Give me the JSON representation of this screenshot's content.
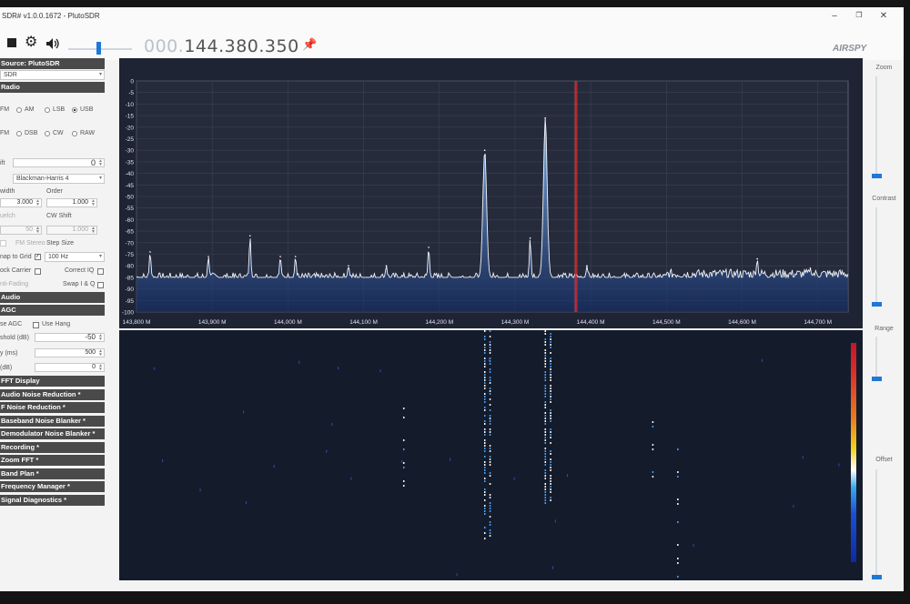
{
  "window": {
    "title": "SDR# v1.0.0.1672 - PlutoSDR",
    "minimize_icon": "minimize-icon",
    "maximize_icon": "restore-icon",
    "close_icon": "close-icon"
  },
  "toolbar": {
    "stop_icon": "stop-icon",
    "settings_icon": "gear-icon",
    "volume_icon": "speaker-icon",
    "volume_level": 0.45,
    "frequency_dim": "000.",
    "frequency_main": "144.380.350",
    "pin_icon": "pin-icon",
    "logo": "AIRSPY"
  },
  "left_panel": {
    "source_header": "Source: PlutoSDR",
    "source_select": "SDR",
    "radio_header": "Radio",
    "modes_row1": [
      "FM",
      "AM",
      "LSB",
      "USB"
    ],
    "modes_row2": [
      "FM",
      "DSB",
      "CW",
      "RAW"
    ],
    "selected_mode": "USB",
    "shift_label": "ift",
    "shift_value": "0",
    "window_select": "Blackman-Harris 4",
    "width_label": "width",
    "order_label": "Order",
    "width_value": "3.000",
    "order_value": "1.000",
    "squelch_label": "uelch",
    "cw_shift_label": "CW Shift",
    "squelch_value": "50",
    "cw_shift_value": "1.000",
    "fm_stereo_label": "FM Stereo",
    "step_size_label": "Step Size",
    "snap_label": "nap to Grid",
    "snap_checked": "✓",
    "step_select": "100 Hz",
    "lock_carrier_label": "ock Carrier",
    "correct_iq_label": "Correct IQ",
    "anti_fading_label": "nti-Fading",
    "swap_iq_label": "Swap I & Q",
    "audio_header": "Audio",
    "agc_header": "AGC",
    "use_agc_label": "se AGC",
    "use_hang_label": "Use Hang",
    "threshold_label": "shold (dB)",
    "threshold_value": "-50",
    "decay_label": "y (ms)",
    "decay_value": "500",
    "slope_label": "(dB)",
    "slope_value": "0",
    "plugin_headers": [
      "FFT Display",
      "Audio Noise Reduction *",
      "F Noise Reduction *",
      "Baseband Noise Blanker *",
      "Demodulator Noise Blanker *",
      "Recording *",
      "Zoom FFT *",
      "Band Plan *",
      "Frequency Manager *",
      "Signal Diagnostics *"
    ]
  },
  "right_panel": {
    "zoom_label": "Zoom",
    "contrast_label": "Contrast",
    "range_label": "Range",
    "offset_label": "Offset"
  },
  "chart_data": {
    "type": "line",
    "title": "",
    "xlabel": "",
    "ylabel": "",
    "y_ticks": [
      0,
      -5,
      -10,
      -15,
      -20,
      -25,
      -30,
      -35,
      -40,
      -45,
      -50,
      -55,
      -60,
      -65,
      -70,
      -75,
      -80,
      -85,
      -90,
      -95,
      -100
    ],
    "ylim": [
      -100,
      0
    ],
    "x_ticks": [
      "143,800 M",
      "143,900 M",
      "144,000 M",
      "144,100 M",
      "144,200 M",
      "144,300 M",
      "144,400 M",
      "144,500 M",
      "144,600 M",
      "144,700 M"
    ],
    "xlim_mhz": [
      143.8,
      144.74
    ],
    "tuned_frequency_mhz": 144.38035,
    "noise_floor_db": -85,
    "peaks": [
      {
        "x_mhz": 143.818,
        "y_db": -74
      },
      {
        "x_mhz": 143.895,
        "y_db": -76
      },
      {
        "x_mhz": 143.95,
        "y_db": -67
      },
      {
        "x_mhz": 143.99,
        "y_db": -76
      },
      {
        "x_mhz": 144.01,
        "y_db": -76
      },
      {
        "x_mhz": 144.08,
        "y_db": -80
      },
      {
        "x_mhz": 144.13,
        "y_db": -80
      },
      {
        "x_mhz": 144.186,
        "y_db": -72
      },
      {
        "x_mhz": 144.26,
        "y_db": -30
      },
      {
        "x_mhz": 144.32,
        "y_db": -68
      },
      {
        "x_mhz": 144.34,
        "y_db": -16
      },
      {
        "x_mhz": 144.395,
        "y_db": -80
      },
      {
        "x_mhz": 144.62,
        "y_db": -77
      },
      {
        "x_mhz": 144.69,
        "y_db": -81
      }
    ],
    "waterfall_traces_mhz": [
      144.26,
      144.267,
      144.34,
      144.347,
      144.153,
      144.482,
      144.515
    ]
  }
}
